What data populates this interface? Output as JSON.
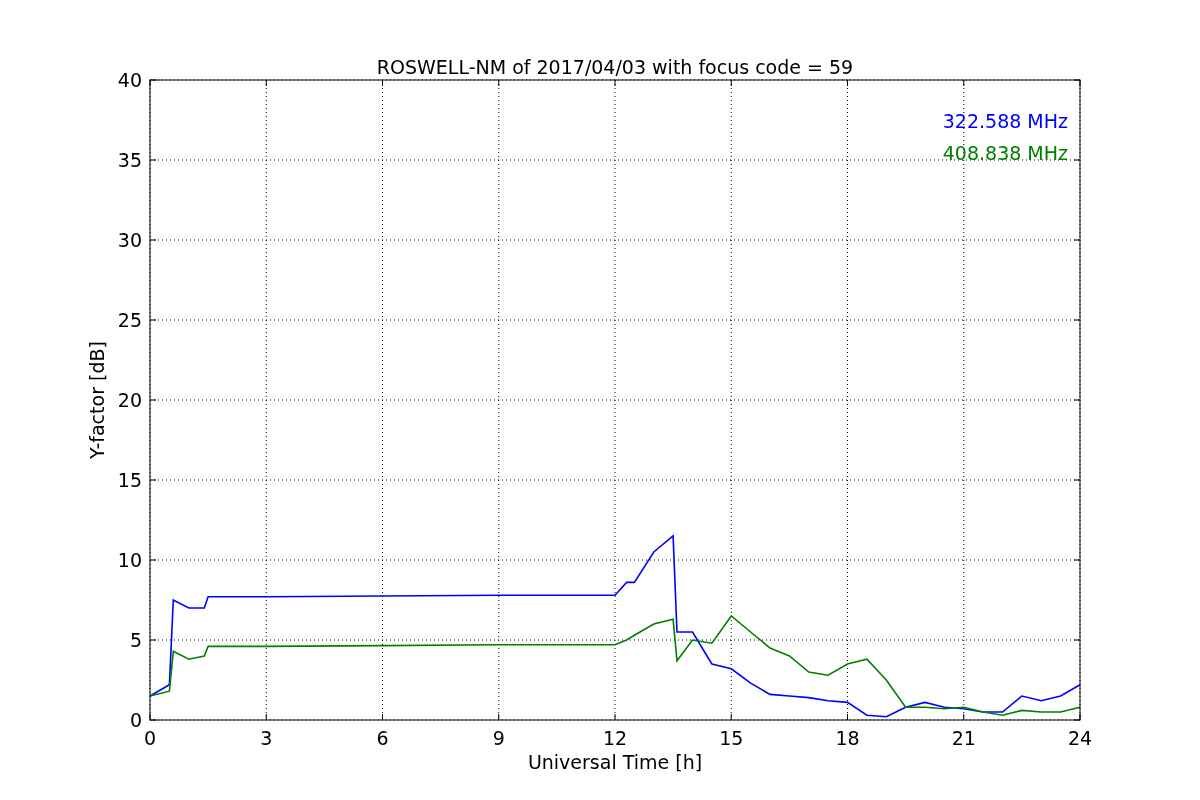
{
  "chart_data": {
    "type": "line",
    "title": "ROSWELL-NM of 2017/04/03 with focus code = 59",
    "xlabel": "Universal Time [h]",
    "ylabel": "Y-factor [dB]",
    "x": [
      0,
      0.5,
      0.6,
      1.0,
      1.4,
      1.5,
      3,
      6,
      9,
      12,
      12.3,
      12.5,
      13,
      13.5,
      13.6,
      14,
      14.5,
      15,
      15.5,
      16,
      16.5,
      17,
      17.5,
      18,
      18.5,
      19,
      19.5,
      20,
      20.5,
      21,
      21.5,
      22,
      22.5,
      23,
      23.5,
      24
    ],
    "series": [
      {
        "name": "322.588 MHz",
        "color": "#0000ff",
        "values": [
          1.5,
          2.2,
          7.5,
          7.0,
          7.0,
          7.7,
          7.7,
          7.75,
          7.8,
          7.8,
          8.6,
          8.6,
          10.5,
          11.5,
          5.5,
          5.5,
          3.5,
          3.2,
          2.3,
          1.6,
          1.5,
          1.4,
          1.2,
          1.1,
          0.3,
          0.2,
          0.8,
          1.1,
          0.8,
          0.7,
          0.5,
          0.5,
          1.5,
          1.2,
          1.5,
          2.2
        ]
      },
      {
        "name": "408.838 MHz",
        "color": "#008000",
        "values": [
          1.5,
          1.8,
          4.3,
          3.8,
          4.0,
          4.6,
          4.6,
          4.65,
          4.7,
          4.7,
          5.0,
          5.3,
          6.0,
          6.3,
          3.7,
          5.0,
          4.8,
          6.5,
          5.5,
          4.5,
          4.0,
          3.0,
          2.8,
          3.5,
          3.8,
          2.5,
          0.8,
          0.8,
          0.7,
          0.8,
          0.5,
          0.3,
          0.6,
          0.5,
          0.5,
          0.8
        ]
      }
    ],
    "xlim": [
      0,
      24
    ],
    "ylim": [
      0,
      40
    ],
    "xticks": [
      0,
      3,
      6,
      9,
      12,
      15,
      18,
      21,
      24
    ],
    "yticks": [
      0,
      5,
      10,
      15,
      20,
      25,
      30,
      35,
      40
    ],
    "grid": true
  }
}
